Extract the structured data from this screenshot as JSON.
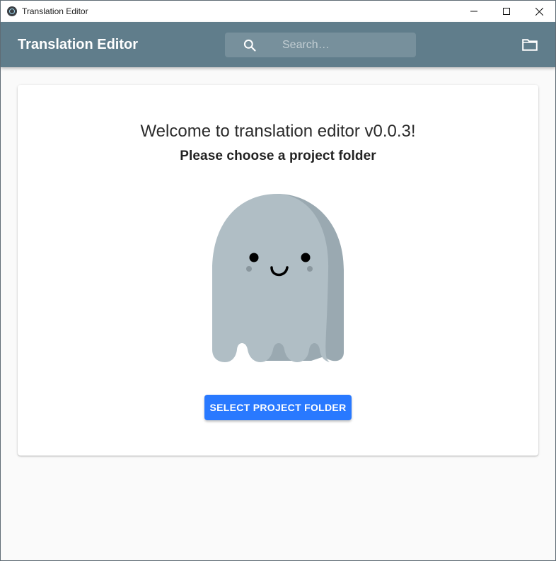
{
  "window": {
    "title": "Translation Editor",
    "controls": [
      "minimize",
      "maximize",
      "close"
    ]
  },
  "appbar": {
    "title": "Translation Editor",
    "search": {
      "placeholder": "Search…",
      "value": "",
      "icon": "search-icon"
    },
    "folder_icon": "folder-icon",
    "background_color": "#607d8b"
  },
  "main": {
    "welcome": "Welcome to translation editor v0.0.3!",
    "subtitle": "Please choose a project folder",
    "illustration": "ghost-illustration",
    "button_label": "SELECT PROJECT FOLDER",
    "button_color": "#2979ff"
  }
}
